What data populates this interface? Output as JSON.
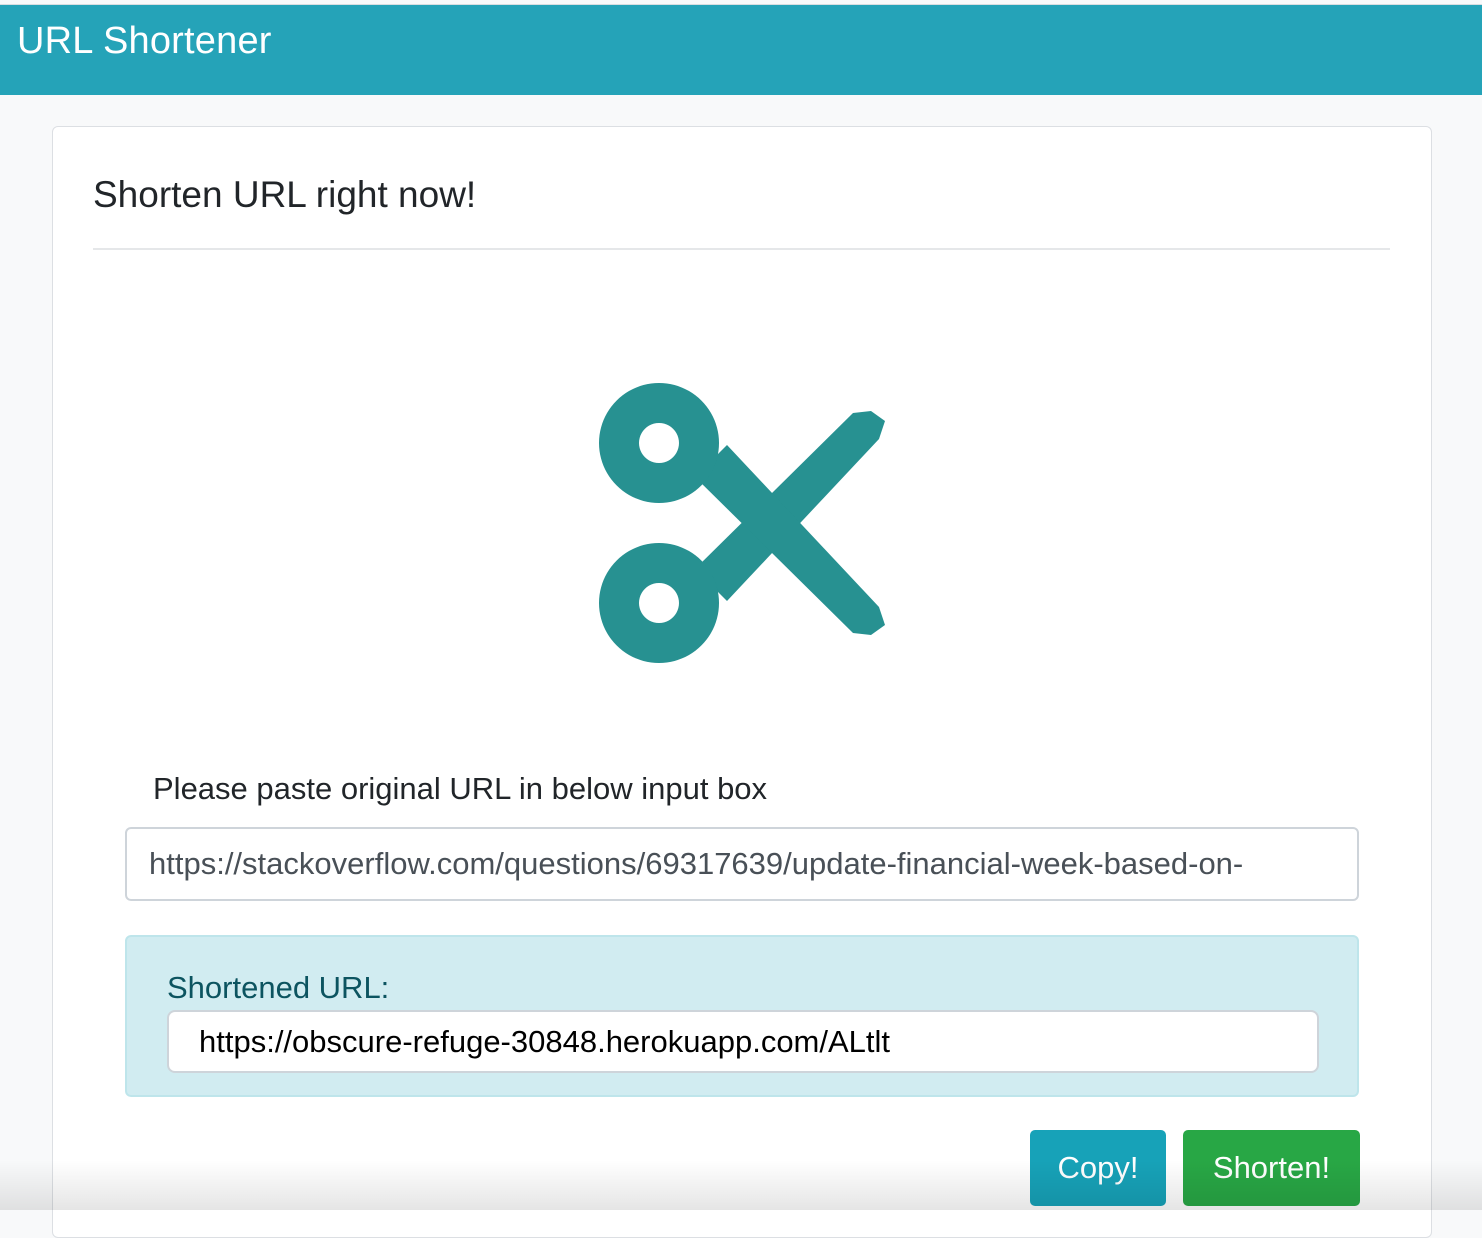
{
  "navbar": {
    "brand": "URL Shortener"
  },
  "card": {
    "title": "Shorten URL right now!",
    "logo_icon": "scissors-icon",
    "logo_color": "#279191",
    "prompt_label": "Please paste original URL in below input box",
    "original_url_value": "https://stackoverflow.com/questions/69317639/update-financial-week-based-on-",
    "result": {
      "label": "Shortened URL:",
      "short_url_value": "https://obscure-refuge-30848.herokuapp.com/ALtlt"
    },
    "buttons": {
      "copy_label": "Copy!",
      "shorten_label": "Shorten!"
    }
  },
  "colors": {
    "navbar": "#25a3b8",
    "info_box": "#d1ecf1",
    "copy_button": "#17a2b8",
    "shorten_button": "#28a745"
  }
}
